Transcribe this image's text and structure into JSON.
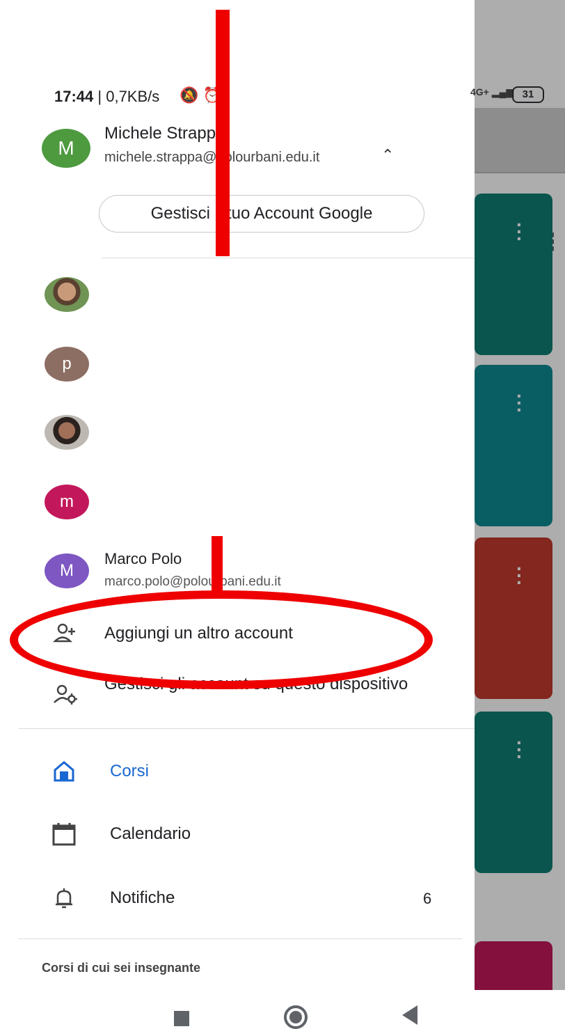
{
  "status_bar": {
    "time": "17:44",
    "speed": " | 0,7KB/s",
    "left_icons": "🔕 ⏰",
    "network": "4G+",
    "battery": "31"
  },
  "account": {
    "avatar_letter": "M",
    "name": "Michele Strappa",
    "email": "michele.strappa@polourbani.edu.it",
    "manage_button": "Gestisci il tuo Account Google"
  },
  "other_accounts": [
    {
      "letter": "p"
    },
    {
      "letter": "m"
    }
  ],
  "marco": {
    "avatar_letter": "M",
    "name": "Marco Polo",
    "email": "marco.polo@polourbani.edu.it"
  },
  "actions": {
    "add_account": "Aggiungi un altro account",
    "manage_devices": "Gestisci gli account su questo dispositivo"
  },
  "nav": {
    "corsi": "Corsi",
    "calendario": "Calendario",
    "notifiche": "Notifiche",
    "notifiche_count": "6"
  },
  "section": {
    "teacher_courses": "Corsi di cui sei insegnante"
  },
  "colors": {
    "accent": "#1967d2",
    "annotation": "#ee0000"
  }
}
